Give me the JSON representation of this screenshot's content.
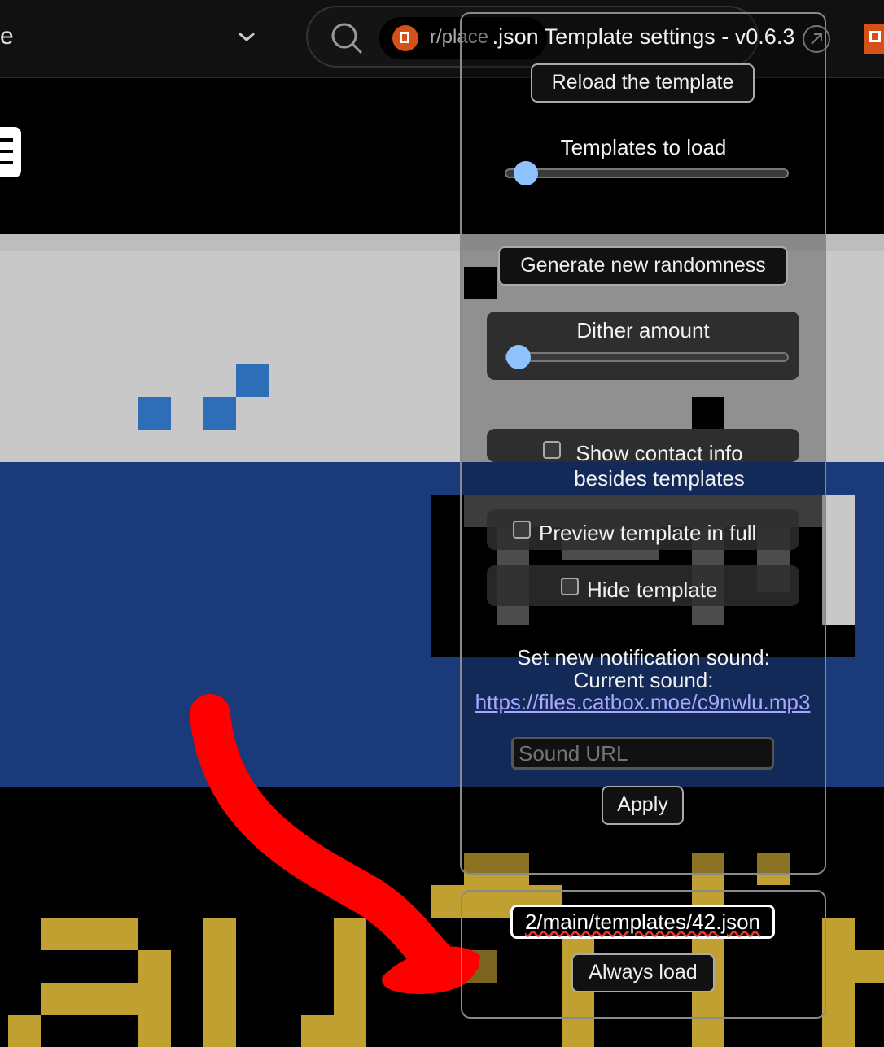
{
  "browser": {
    "left_text": "e",
    "chip_label": "r/place",
    "search_icon": "search-icon",
    "chevron_icon": "chevron-down-icon"
  },
  "panel": {
    "title": ".json Template settings - v0.6.3",
    "reload_label": "Reload the template",
    "templates_to_load_label": "Templates to load",
    "generate_label": "Generate new randomness",
    "dither_label": "Dither amount",
    "show_contact_label": "Show contact info besides templates",
    "preview_label": "Preview template in full",
    "hide_label": "Hide template",
    "notif_label": "Set new notification sound:",
    "current_sound_label": "Current sound:",
    "sound_url": "https://files.catbox.moe/c9nwlu.mp3",
    "sound_placeholder": "Sound URL",
    "apply_label": "Apply",
    "template_url_value": "2/main/templates/42.json",
    "always_load_label": "Always load"
  },
  "colors": {
    "accent_blue": "#8ec3ff",
    "canvas_blue": "#1b3a7a",
    "canvas_gray": "#c8c8c8",
    "canvas_gold": "#c0a030",
    "arrow_red": "#ff0000"
  }
}
